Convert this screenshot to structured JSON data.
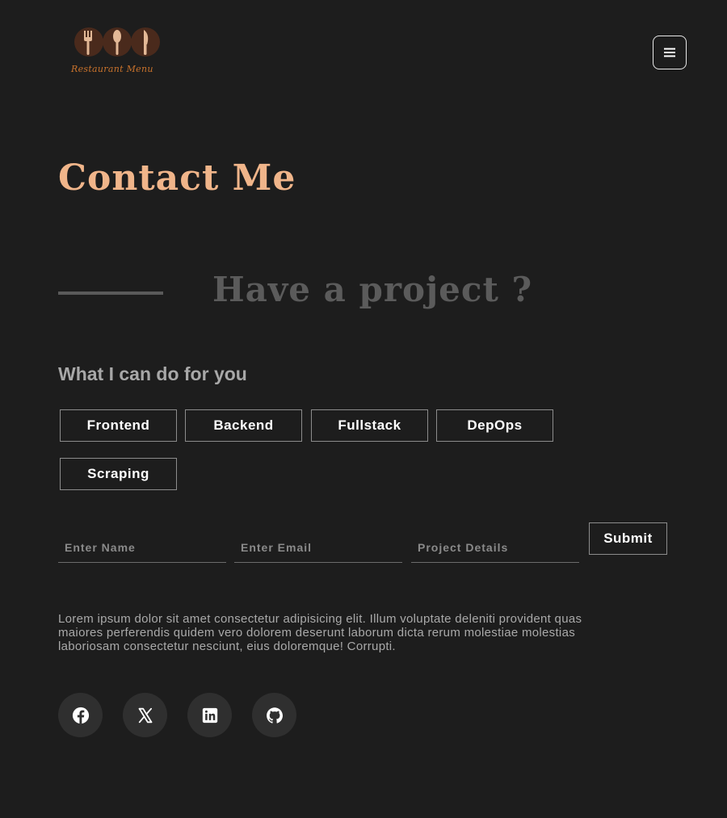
{
  "header": {
    "logo_text": "Restaurant Menu",
    "menu_button": "menu-icon"
  },
  "main": {
    "title": "Contact Me",
    "section_heading": "Have a project ?",
    "subheading": "What I can do for you",
    "services": [
      "Frontend",
      "Backend",
      "Fullstack",
      "DepOps",
      "Scraping"
    ]
  },
  "form": {
    "name_placeholder": "Enter Name",
    "email_placeholder": "Enter Email",
    "details_placeholder": "Project Details",
    "submit_label": "Submit"
  },
  "description": "Lorem ipsum dolor sit amet consectetur adipisicing elit. Illum voluptate deleniti provident quas maiores perferendis quidem vero dolorem deserunt laborum dicta rerum molestiae molestias laboriosam consectetur nesciunt, eius doloremque! Corrupti.",
  "social": [
    {
      "icon": "facebook-icon"
    },
    {
      "icon": "x-icon"
    },
    {
      "icon": "linkedin-icon"
    },
    {
      "icon": "github-icon"
    }
  ],
  "colors": {
    "background": "#1d1d1d",
    "title": "#f0b58a",
    "heading_muted": "#5b5b5b",
    "logo_accent": "#c8722c",
    "social_bg": "#2f2f2f"
  }
}
